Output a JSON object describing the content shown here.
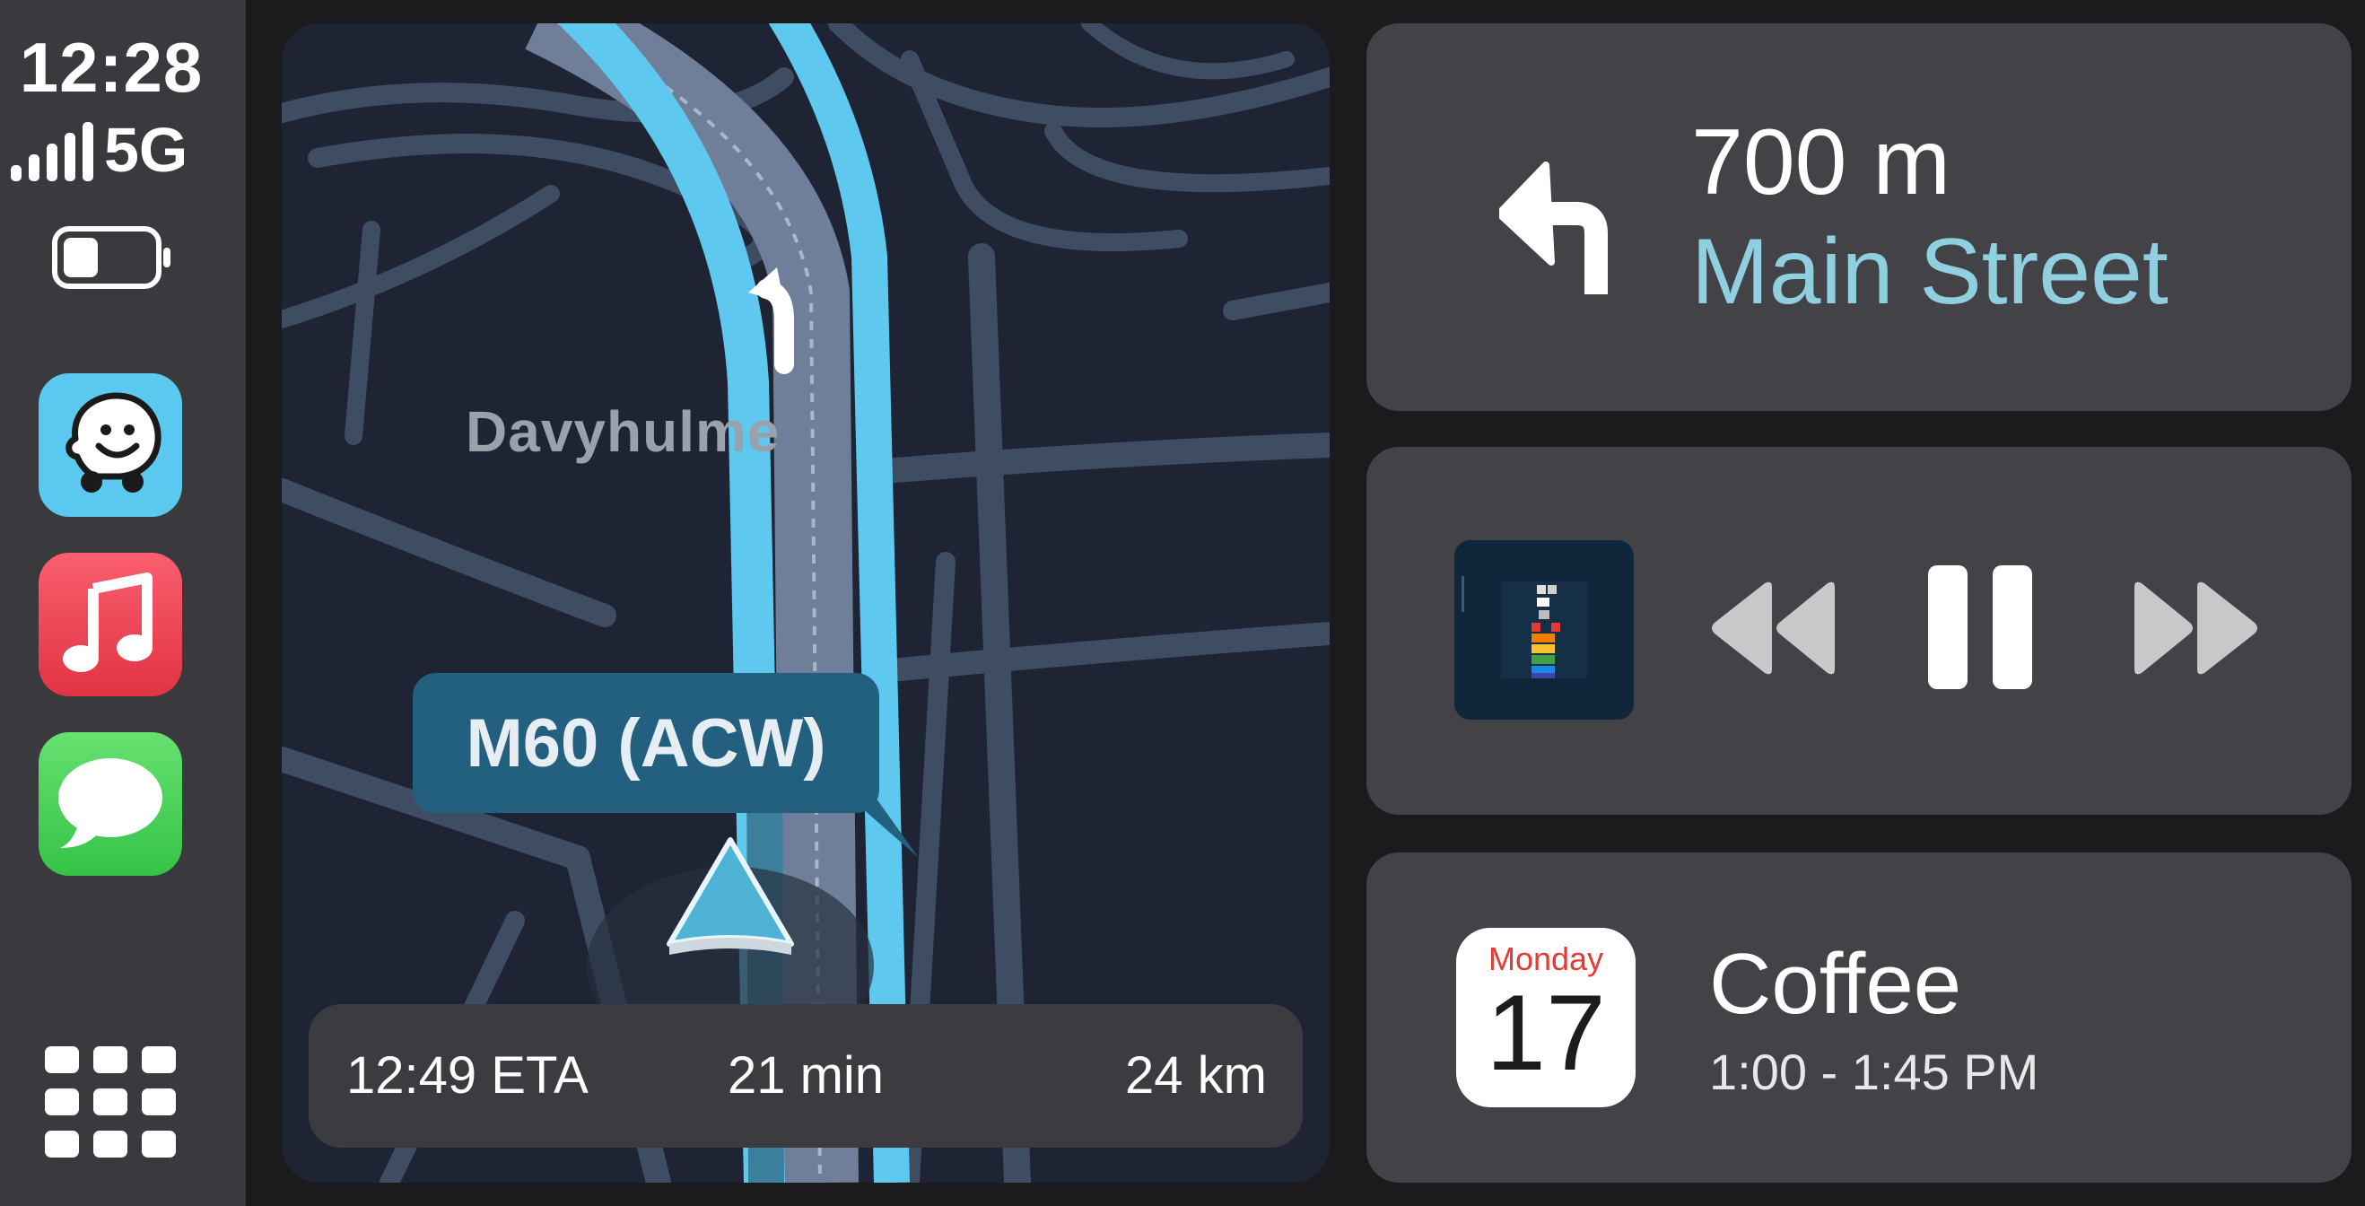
{
  "status": {
    "time": "12:28",
    "network": "5G",
    "battery_level": 0.4
  },
  "dock": {
    "apps": [
      {
        "name": "Waze",
        "icon": "waze-icon"
      },
      {
        "name": "Music",
        "icon": "music-note-icon"
      },
      {
        "name": "Messages",
        "icon": "chat-bubble-icon"
      }
    ],
    "launcher_icon": "app-grid-icon"
  },
  "map": {
    "place_label": "Davyhulme",
    "road_label": "M60 (ACW)",
    "trip": {
      "eta": "12:49 ETA",
      "duration": "21 min",
      "distance": "24 km"
    }
  },
  "navigation": {
    "maneuver_icon": "turn-left-arrow-icon",
    "distance": "700 m",
    "street": "Main Street"
  },
  "media": {
    "controls": [
      "rewind-icon",
      "pause-icon",
      "fast-forward-icon"
    ]
  },
  "calendar": {
    "day_name": "Monday",
    "date": "17",
    "event_title": "Coffee",
    "event_time": "1:00 - 1:45 PM"
  },
  "colors": {
    "background": "#1b1b1d",
    "card": "#434347",
    "route_highlight": "#5ec8ee",
    "street_accent": "#8fcfe0",
    "calendar_red": "#e53935"
  }
}
